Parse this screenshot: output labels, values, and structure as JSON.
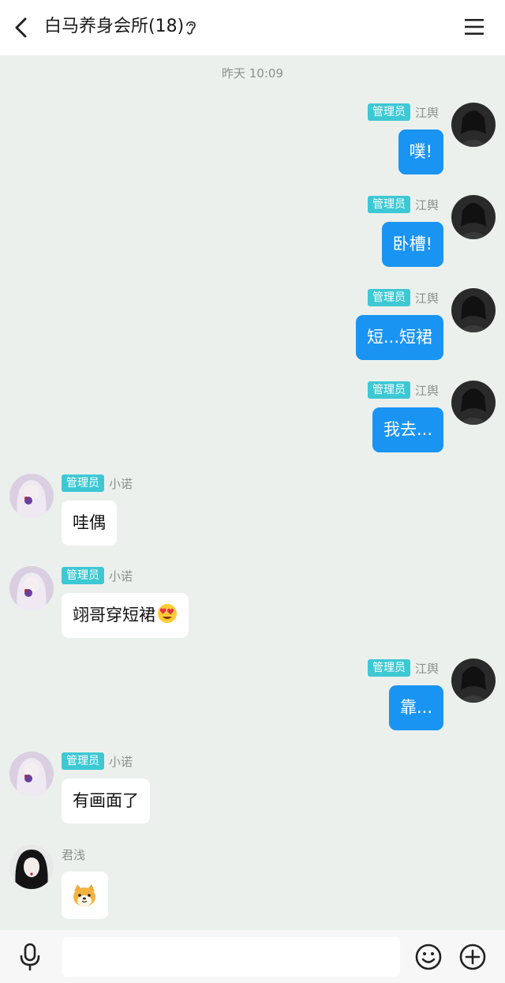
{
  "header": {
    "title": "白马养身会所(18)",
    "back_icon": "back-arrow-icon",
    "ear_icon": "ear-icon",
    "menu_icon": "hamburger-menu-icon"
  },
  "timestamp": "昨天 10:09",
  "admin_badge": "管理员",
  "messages": [
    {
      "side": "right",
      "sender": "江舆",
      "badge": "管理员",
      "text": "噗!"
    },
    {
      "side": "right",
      "sender": "江舆",
      "badge": "管理员",
      "text": "卧槽!"
    },
    {
      "side": "right",
      "sender": "江舆",
      "badge": "管理员",
      "text": "短...短裙"
    },
    {
      "side": "right",
      "sender": "江舆",
      "badge": "管理员",
      "text": "我去..."
    },
    {
      "side": "left",
      "sender": "小诺",
      "badge": "管理员",
      "text": "哇偶"
    },
    {
      "side": "left",
      "sender": "小诺",
      "badge": "管理员",
      "text": "翊哥穿短裙",
      "emoji": "heart-eyes-emoji"
    },
    {
      "side": "right",
      "sender": "江舆",
      "badge": "管理员",
      "text": "靠..."
    },
    {
      "side": "left",
      "sender": "小诺",
      "badge": "管理员",
      "text": "有画面了"
    },
    {
      "side": "left",
      "sender": "君浅",
      "badge": "",
      "text": "",
      "emoji": "shiba-dog-emoji"
    }
  ],
  "bottom": {
    "input_value": "",
    "mic_icon": "microphone-icon",
    "emoji_icon": "smiley-icon",
    "plus_icon": "plus-circle-icon"
  },
  "colors": {
    "background": "#ebf0ed",
    "self_bubble": "#1a94f2",
    "other_bubble": "#ffffff",
    "admin_badge": "#3dc8d4"
  }
}
